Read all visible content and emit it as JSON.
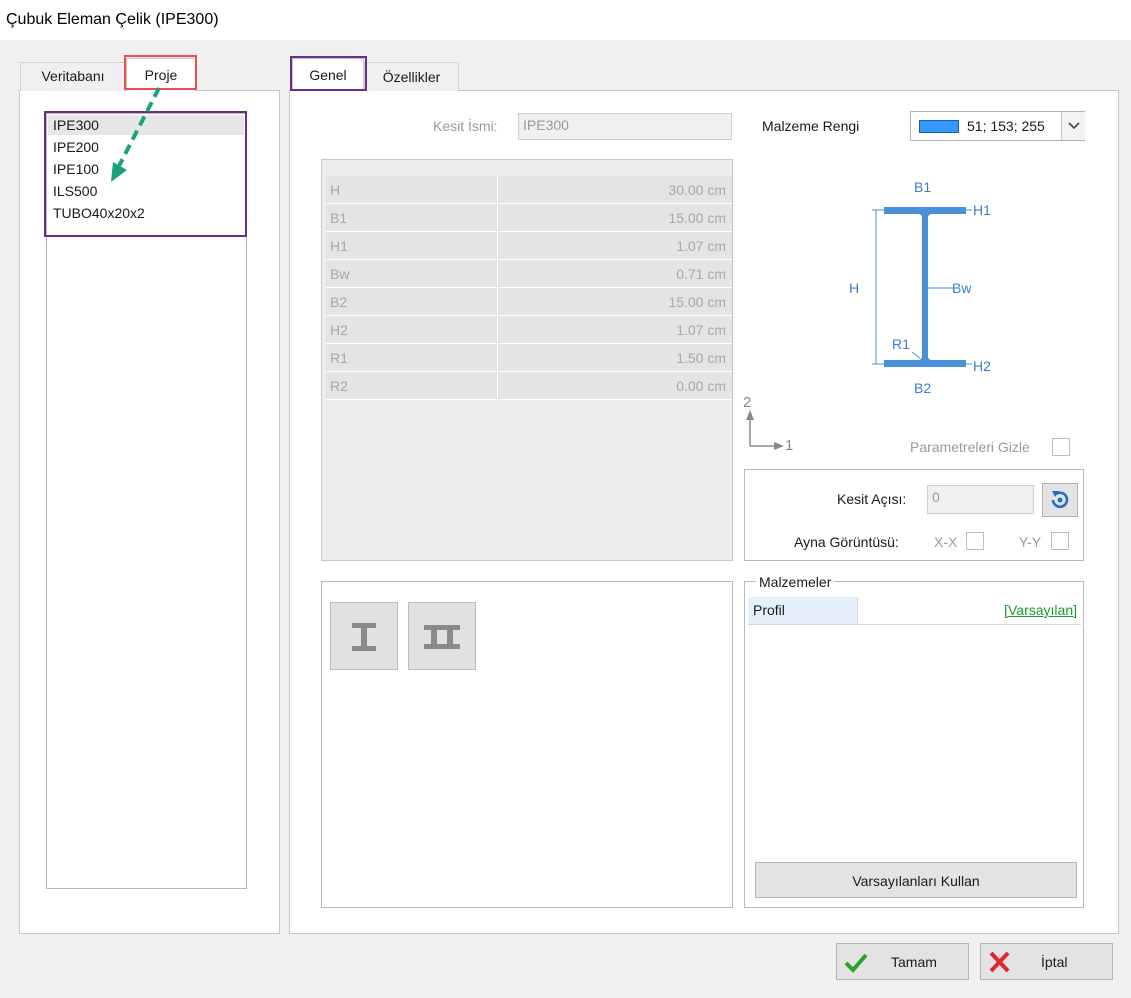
{
  "window": {
    "title": "Çubuk Eleman Çelik (IPE300)"
  },
  "left_tabs": [
    {
      "label": "Veritabanı"
    },
    {
      "label": "Proje"
    }
  ],
  "section_list": {
    "items": [
      "IPE300",
      "IPE200",
      "IPE100",
      "ILS500",
      "TUBO40x20x2"
    ],
    "selected": "IPE300"
  },
  "right_tabs": [
    {
      "label": "Genel"
    },
    {
      "label": "Özellikler"
    }
  ],
  "general": {
    "section_name_label": "Kesit İsmi:",
    "section_name_value": "IPE300",
    "material_color_label": "Malzeme Rengi",
    "material_color_value": "51; 153; 255",
    "material_color_hex": "#3399ff"
  },
  "parameters": [
    {
      "name": "H",
      "value": "30.00 cm"
    },
    {
      "name": "B1",
      "value": "15.00 cm"
    },
    {
      "name": "H1",
      "value": "1.07 cm"
    },
    {
      "name": "Bw",
      "value": "0.71 cm"
    },
    {
      "name": "B2",
      "value": "15.00 cm"
    },
    {
      "name": "H2",
      "value": "1.07 cm"
    },
    {
      "name": "R1",
      "value": "1.50 cm"
    },
    {
      "name": "R2",
      "value": "0.00 cm"
    }
  ],
  "diagram": {
    "labels": {
      "b1": "B1",
      "h1": "H1",
      "h": "H",
      "bw": "Bw",
      "r1": "R1",
      "h2": "H2",
      "b2": "B2"
    },
    "axis_vertical": "2",
    "axis_horizontal": "1",
    "shape_color": "#4a90d9"
  },
  "hide_params_label": "Parametreleri Gizle",
  "orientation": {
    "angle_label": "Kesit Açısı:",
    "angle_value": "0",
    "mirror_label": "Ayna Görüntüsü:",
    "mirror_xx": "X-X",
    "mirror_yy": "Y-Y"
  },
  "materials": {
    "group_title": "Malzemeler",
    "profile_label": "Profil",
    "profile_value": "[Varsayılan]",
    "use_defaults_button": "Varsayılanları Kullan"
  },
  "buttons": {
    "ok": "Tamam",
    "cancel": "İptal"
  },
  "icons": {
    "rotate": "rotate-icon",
    "ok": "checkmark-icon",
    "cancel": "x-mark-icon",
    "i_section": "i-section-icon",
    "double_i_section": "double-i-section-icon"
  },
  "colors": {
    "highlight_red": "#e8514a",
    "highlight_purple": "#6a2c8f",
    "arrow_teal": "#1aa37a",
    "link_green": "#1a9a2a"
  }
}
